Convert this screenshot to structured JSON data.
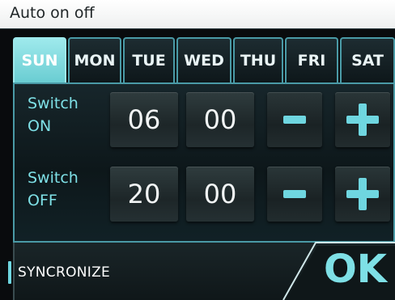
{
  "window": {
    "title": "Auto on off"
  },
  "tabs": [
    {
      "label": "SUN",
      "active": true
    },
    {
      "label": "MON",
      "active": false
    },
    {
      "label": "TUE",
      "active": false
    },
    {
      "label": "WED",
      "active": false
    },
    {
      "label": "THU",
      "active": false
    },
    {
      "label": "FRI",
      "active": false
    },
    {
      "label": "SAT",
      "active": false
    }
  ],
  "switch_on": {
    "label_line1": "Switch",
    "label_line2": "ON",
    "hour": "06",
    "minute": "00"
  },
  "switch_off": {
    "label_line1": "Switch",
    "label_line2": "OFF",
    "hour": "20",
    "minute": "00"
  },
  "controls": {
    "minus_icon": "minus-icon",
    "plus_icon": "plus-icon"
  },
  "footer": {
    "sync_label": "SYNCRONIZE",
    "ok_label": "OK"
  },
  "colors": {
    "accent": "#6fd6e0",
    "active_tab": "#8fe2e6",
    "border": "#4a9aa6"
  }
}
